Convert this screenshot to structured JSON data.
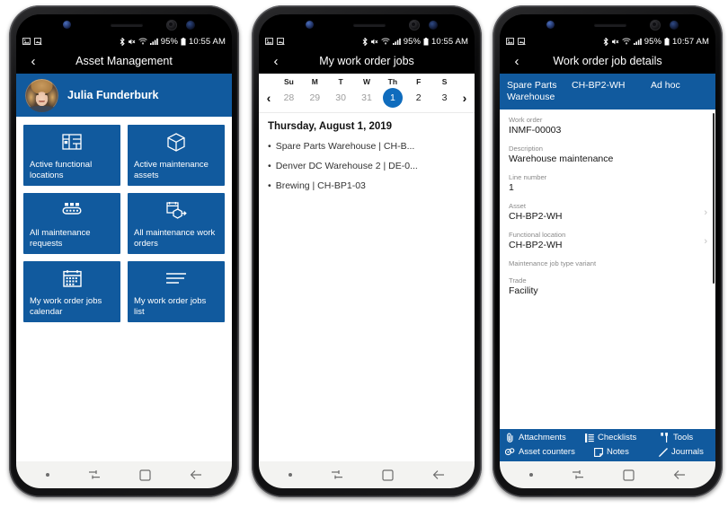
{
  "colors": {
    "brand_blue": "#115a9e",
    "accent_blue": "#0f6cbd",
    "status_bar_bg": "#000000",
    "nav_bar_bg": "#f3f3f1",
    "label_gray": "#8a8a8a"
  },
  "phone1": {
    "status": {
      "battery_percent": "95%",
      "time": "10:55 AM",
      "icons": [
        "image-icon",
        "screenshot-icon",
        "bluetooth-icon",
        "mute-icon",
        "wifi-icon",
        "signal-icon",
        "battery-icon"
      ]
    },
    "appbar": {
      "back": "‹",
      "title": "Asset Management"
    },
    "profile": {
      "name": "Julia Funderburk"
    },
    "tiles": [
      {
        "label": "Active functional locations",
        "icon": "floorplan-icon"
      },
      {
        "label": "Active maintenance assets",
        "icon": "box-icon"
      },
      {
        "label": "All maintenance requests",
        "icon": "conveyor-icon"
      },
      {
        "label": "All maintenance work orders",
        "icon": "workorder-icon"
      },
      {
        "label": "My work order jobs calendar",
        "icon": "calendar-icon"
      },
      {
        "label": "My work order jobs list",
        "icon": "list-icon"
      }
    ],
    "navbar": [
      "dot-icon",
      "recents-icon",
      "home-icon",
      "back-icon"
    ]
  },
  "phone2": {
    "status": {
      "battery_percent": "95%",
      "time": "10:55 AM"
    },
    "appbar": {
      "back": "‹",
      "title": "My work order jobs"
    },
    "calendar": {
      "prev": "‹",
      "next": "›",
      "day_headers": [
        "Su",
        "M",
        "T",
        "W",
        "Th",
        "F",
        "S"
      ],
      "dates": [
        {
          "n": "28",
          "state": "out"
        },
        {
          "n": "29",
          "state": "out"
        },
        {
          "n": "30",
          "state": "out"
        },
        {
          "n": "31",
          "state": "out"
        },
        {
          "n": "1",
          "state": "selected"
        },
        {
          "n": "2",
          "state": "in"
        },
        {
          "n": "3",
          "state": "in"
        }
      ],
      "selected_day_header": "Thursday, August 1, 2019"
    },
    "jobs": [
      "Spare Parts Warehouse | CH-B...",
      "Denver DC Warehouse 2 | DE-0...",
      "Brewing | CH-BP1-03"
    ],
    "navbar": [
      "dot-icon",
      "recents-icon",
      "home-icon",
      "back-icon"
    ]
  },
  "phone3": {
    "status": {
      "battery_percent": "95%",
      "time": "10:57 AM"
    },
    "appbar": {
      "back": "‹",
      "title": "Work order job details"
    },
    "tabs": [
      "Spare Parts Warehouse",
      "CH-BP2-WH",
      "Ad hoc"
    ],
    "fields": [
      {
        "label": "Work order",
        "value": "INMF-00003",
        "chevron": false
      },
      {
        "label": "Description",
        "value": "Warehouse maintenance",
        "chevron": false
      },
      {
        "label": "Line number",
        "value": "1",
        "chevron": false
      },
      {
        "label": "Asset",
        "value": "CH-BP2-WH",
        "chevron": true
      },
      {
        "label": "Functional location",
        "value": "CH-BP2-WH",
        "chevron": true
      },
      {
        "label": "Maintenance job type variant",
        "value": "",
        "chevron": false
      },
      {
        "label": "Trade",
        "value": "Facility",
        "chevron": false
      }
    ],
    "actions": [
      {
        "label": "Attachments",
        "icon": "paperclip-icon"
      },
      {
        "label": "Checklists",
        "icon": "checklist-icon"
      },
      {
        "label": "Tools",
        "icon": "tools-icon"
      },
      {
        "label": "Asset counters",
        "icon": "counter-icon"
      },
      {
        "label": "Notes",
        "icon": "note-icon"
      },
      {
        "label": "Journals",
        "icon": "pencil-icon"
      }
    ],
    "navbar": [
      "dot-icon",
      "recents-icon",
      "home-icon",
      "back-icon"
    ]
  }
}
